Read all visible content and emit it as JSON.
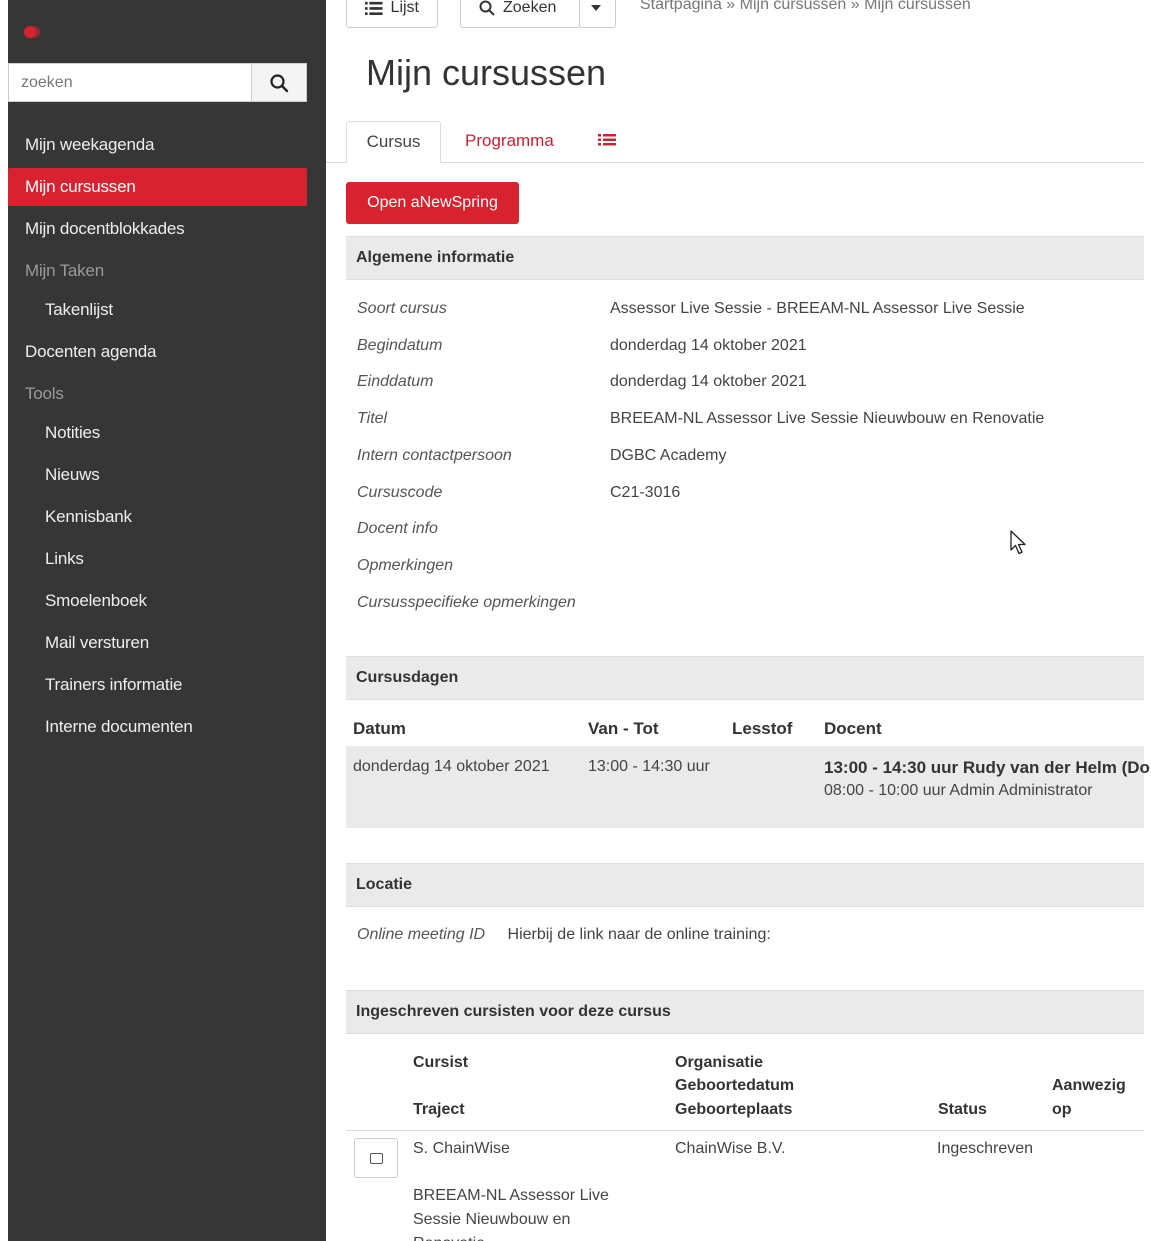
{
  "sidebar": {
    "search": {
      "placeholder": "zoeken"
    },
    "items": [
      {
        "label": "Mijn weekagenda"
      },
      {
        "label": "Mijn cursussen"
      },
      {
        "label": "Mijn docentblokkades"
      },
      {
        "label": "Mijn Taken"
      },
      {
        "label": "Takenlijst"
      },
      {
        "label": "Docenten agenda"
      },
      {
        "label": "Tools"
      },
      {
        "label": "Notities"
      },
      {
        "label": "Nieuws"
      },
      {
        "label": "Kennisbank"
      },
      {
        "label": "Links"
      },
      {
        "label": "Smoelenboek"
      },
      {
        "label": "Mail versturen"
      },
      {
        "label": "Trainers informatie"
      },
      {
        "label": "Interne documenten"
      }
    ]
  },
  "toolbar": {
    "list_label": "Lijst",
    "search_label": "Zoeken"
  },
  "breadcrumb": "Startpagina » Mijn cursussen » Mijn cursussen",
  "page_title": "Mijn cursussen",
  "tabs": {
    "cursus": "Cursus",
    "programma": "Programma"
  },
  "open_button": "Open aNewSpring",
  "general": {
    "heading": "Algemene informatie",
    "rows": [
      {
        "label": "Soort cursus",
        "value": "Assessor Live Sessie - BREEAM-NL Assessor Live Sessie"
      },
      {
        "label": "Begindatum",
        "value": "donderdag 14 oktober 2021"
      },
      {
        "label": "Einddatum",
        "value": "donderdag 14 oktober 2021"
      },
      {
        "label": "Titel",
        "value": "BREEAM-NL Assessor Live Sessie Nieuwbouw en Renovatie"
      },
      {
        "label": "Intern contactpersoon",
        "value": "DGBC Academy"
      },
      {
        "label": "Cursuscode",
        "value": "C21-3016"
      },
      {
        "label": "Docent info",
        "value": ""
      },
      {
        "label": "Opmerkingen",
        "value": ""
      },
      {
        "label": "Cursusspecifieke opmerkingen",
        "value": ""
      }
    ]
  },
  "days": {
    "heading": "Cursusdagen",
    "columns": [
      "Datum",
      "Van - Tot",
      "Lesstof",
      "Docent"
    ],
    "row": {
      "datum": "donderdag 14 oktober 2021",
      "tijd": "13:00 - 14:30 uur",
      "docent_line1": "13:00 - 14:30 uur Rudy van der Helm (Do",
      "docent_line2": "08:00 - 10:00 uur Admin Administrator"
    }
  },
  "location": {
    "heading": "Locatie",
    "label": "Online meeting ID",
    "value": "Hierbij de link naar de online training:"
  },
  "students": {
    "heading": "Ingeschreven cursisten voor deze cursus",
    "columns": {
      "cursist": "Cursist",
      "traject": "Traject",
      "organisatie": "Organisatie",
      "geboortedatum": "Geboortedatum",
      "geboorteplaats": "Geboorteplaats",
      "status": "Status",
      "aanwezig": "Aanwezig",
      "op": "op"
    },
    "rows": [
      {
        "cursist": "S. ChainWise",
        "organisatie": "ChainWise B.V.",
        "status": "Ingeschreven",
        "traject_line1": "BREEAM-NL Assessor Live",
        "traject_line2": "Sessie Nieuwbouw en",
        "traject_line3": "Renovatie"
      }
    ]
  },
  "colors": {
    "accent": "#d8222f",
    "sidebar_bg": "#363636",
    "section_bg": "#eaeaea"
  }
}
